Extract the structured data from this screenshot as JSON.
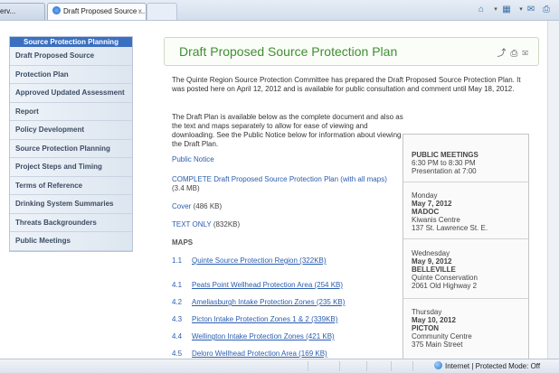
{
  "browser": {
    "tabs": [
      {
        "label": "erv..."
      },
      {
        "label": "Draft Proposed Source ...",
        "close": "×"
      }
    ],
    "status": {
      "zone": "Internet | Protected Mode: Off"
    }
  },
  "sidebar": {
    "header": "Source Protection Planning",
    "items": [
      {
        "label": "Draft Proposed Source"
      },
      {
        "label": "Protection Plan"
      },
      {
        "label": "Approved Updated Assessment"
      },
      {
        "label": "Report"
      },
      {
        "label": "Policy Development"
      },
      {
        "label": "Source Protection Planning"
      },
      {
        "label": "Project Steps and Timing"
      },
      {
        "label": "Terms of Reference"
      },
      {
        "label": "Drinking System Summaries"
      },
      {
        "label": "Threats Backgrounders"
      },
      {
        "label": "Public Meetings"
      }
    ]
  },
  "main": {
    "title": "Draft Proposed Source Protection Plan",
    "intro": "The Quinte Region Source Protection Committee has prepared the Draft Proposed Source Protection Plan. It was posted here on April 12, 2012 and is available for public consultation and comment until May 18, 2012.",
    "available": "The Draft Plan is available below as the complete document and also as the text and maps separately to allow for ease of viewing and downloading. See the Public Notice below for information about viewing the Draft Plan.",
    "public_notice": "Public Notice",
    "complete": {
      "link": "COMPLETE Draft Proposed Source Protection Plan (with all maps)",
      "size": "(3.4 MB)"
    },
    "cover": {
      "link": "Cover",
      "size": "(486 KB)"
    },
    "text_only": {
      "link": "TEXT ONLY",
      "size": "(832KB)"
    },
    "maps_heading": "MAPS",
    "maps": [
      {
        "num": "1.1",
        "label": "Quinte Source Protection Region (322KB)"
      },
      {
        "num": "4.1",
        "label": "Peats Point Wellhead Protection Area (254 KB)"
      },
      {
        "num": "4.2",
        "label": "Ameliasburgh Intake Protection Zones (235 KB)"
      },
      {
        "num": "4.3",
        "label": "Picton Intake Protection Zones 1 & 2 (339KB)"
      },
      {
        "num": "4.4",
        "label": "Wellington Intake Protection Zones (421 KB)"
      },
      {
        "num": "4.5",
        "label": "Deloro Wellhead Protection Area (169 KB)"
      }
    ]
  },
  "events": {
    "heading": "PUBLIC MEETINGS",
    "time": "6:30 PM to 8:30 PM",
    "presentation": "Presentation at 7:00",
    "meetings": [
      {
        "day": "Monday",
        "date": "May 7, 2012",
        "place": "MADOC",
        "venue": "Kiwanis Centre",
        "address": "137 St. Lawrence St. E."
      },
      {
        "day": "Wednesday",
        "date": "May 9, 2012",
        "place": "BELLEVILLE",
        "venue": "Quinte Conservation",
        "address": "2061 Old Highway 2"
      },
      {
        "day": "Thursday",
        "date": "May 10, 2012",
        "place": "PICTON",
        "venue": "Community Centre",
        "address": "375 Main Street"
      }
    ]
  }
}
